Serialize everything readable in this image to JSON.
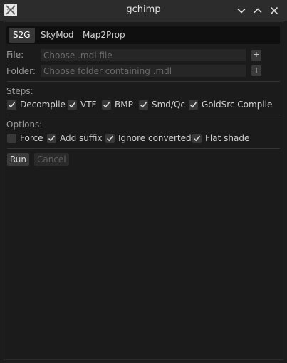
{
  "window": {
    "title": "gchimp",
    "icon": "gchimp-app-icon",
    "controls": [
      "chevron-down-icon",
      "chevron-up-icon",
      "close-icon"
    ]
  },
  "tabs": [
    {
      "label": "S2G",
      "active": true
    },
    {
      "label": "SkyMod",
      "active": false
    },
    {
      "label": "Map2Prop",
      "active": false
    }
  ],
  "file": {
    "label": "File:",
    "value": "",
    "placeholder": "Choose .mdl file",
    "browse_label": "+"
  },
  "folder": {
    "label": "Folder:",
    "value": "",
    "placeholder": "Choose folder containing .mdl",
    "browse_label": "+"
  },
  "steps": {
    "label": "Steps:",
    "items": [
      {
        "label": "Decompile",
        "checked": true
      },
      {
        "label": "VTF",
        "checked": true
      },
      {
        "label": "BMP",
        "checked": true
      },
      {
        "label": "Smd/Qc",
        "checked": true
      },
      {
        "label": "GoldSrc Compile",
        "checked": true
      }
    ]
  },
  "options": {
    "label": "Options:",
    "items": [
      {
        "label": "Force",
        "checked": false
      },
      {
        "label": "Add suffix",
        "checked": true
      },
      {
        "label": "Ignore converted",
        "checked": true
      },
      {
        "label": "Flat shade",
        "checked": true
      }
    ]
  },
  "actions": {
    "run_label": "Run",
    "cancel_label": "Cancel",
    "cancel_enabled": false
  },
  "colors": {
    "background": "#1b1b1b",
    "titlebar": "#2c2c2c",
    "input_bg": "#262626",
    "button_bg": "#3a3a3a",
    "text": "#d0d0d0",
    "muted_text": "#9a9a9a"
  }
}
